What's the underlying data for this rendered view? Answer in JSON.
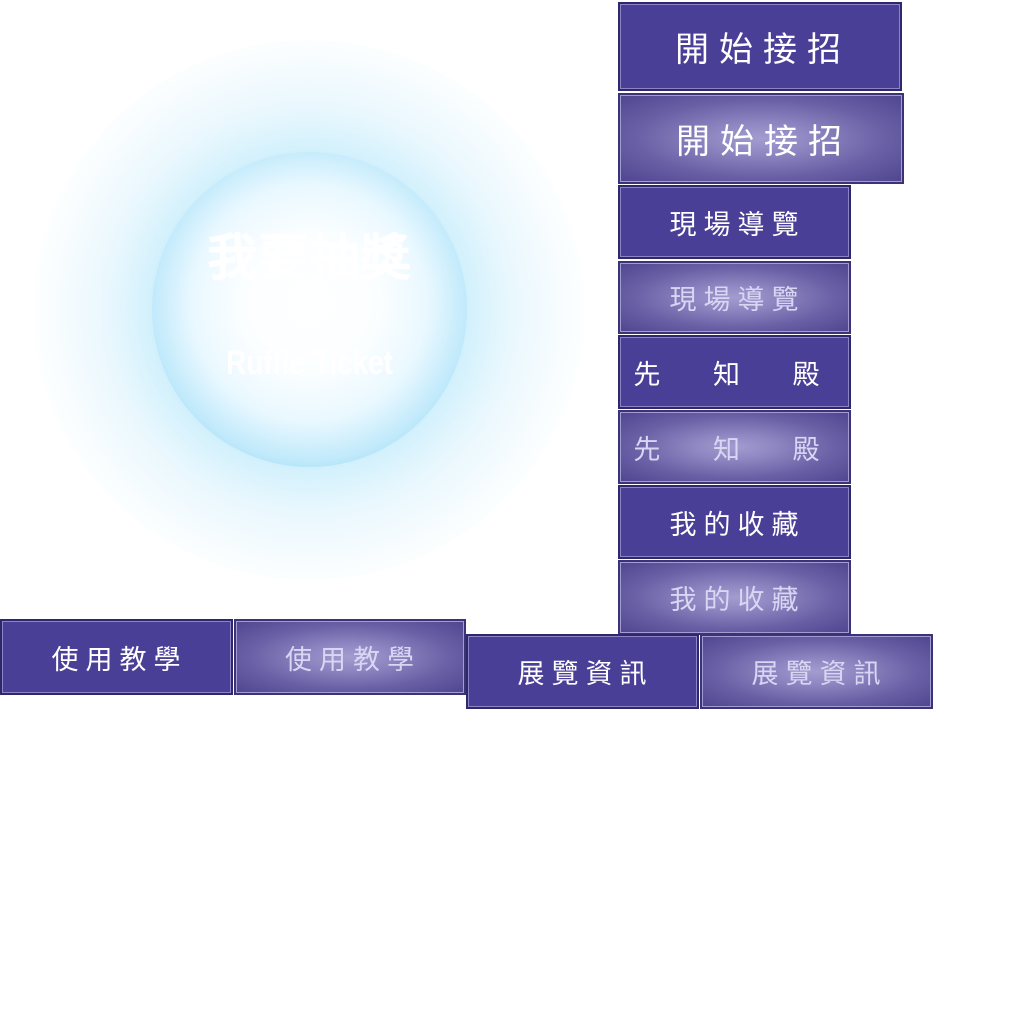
{
  "raffle": {
    "title": "我要抽獎",
    "subtitle": "Ruffle Ticket"
  },
  "menu": {
    "start": {
      "label": "開始接招",
      "label_pressed": "開始接招"
    },
    "tour": {
      "label": "現場導覽",
      "label_pressed": "現場導覽"
    },
    "prophet": {
      "label": "先 知 殿",
      "label_pressed": "先 知 殿"
    },
    "favorites": {
      "label": "我的收藏",
      "label_pressed": "我的收藏"
    },
    "tutorial": {
      "label": "使用教學",
      "label_pressed": "使用教學"
    },
    "exhibition": {
      "label": "展覽資訊",
      "label_pressed": "展覽資訊"
    }
  },
  "colors": {
    "button_primary": "#4a3f96",
    "button_pressed_center": "#a39ccf",
    "orb_edge": "#46b4e8",
    "orb_glow": "#96dcf8"
  }
}
